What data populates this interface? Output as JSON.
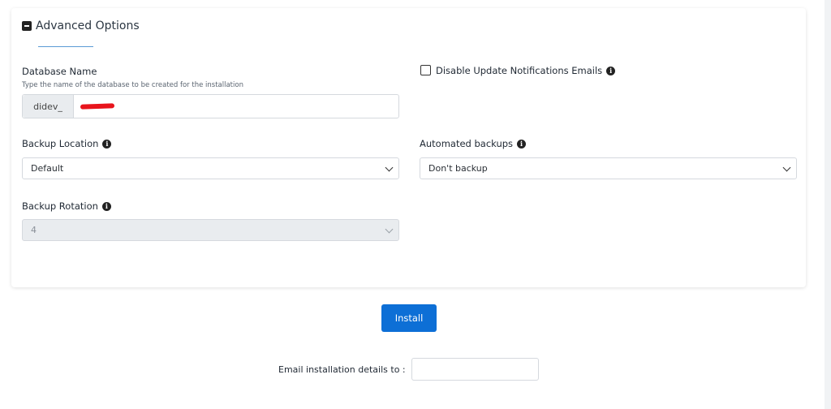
{
  "section": {
    "title": "Advanced Options"
  },
  "database": {
    "label": "Database Name",
    "hint": "Type the name of the database to be created for the installation",
    "prefix": "didev_"
  },
  "notifications": {
    "label": "Disable Update Notifications Emails",
    "checked": false
  },
  "backup_location": {
    "label": "Backup Location",
    "selected": "Default"
  },
  "automated_backups": {
    "label": "Automated backups",
    "selected": "Don't backup"
  },
  "backup_rotation": {
    "label": "Backup Rotation",
    "selected": "4",
    "disabled": true
  },
  "install": {
    "label": "Install"
  },
  "email": {
    "label": "Email installation details to :",
    "value": ""
  },
  "icons": {
    "info": "info-icon",
    "collapse": "minus-square-icon",
    "dropdown": "chevron-down-icon"
  },
  "colors": {
    "primary": "#0d6fd6",
    "redaction": "#e8141c"
  }
}
